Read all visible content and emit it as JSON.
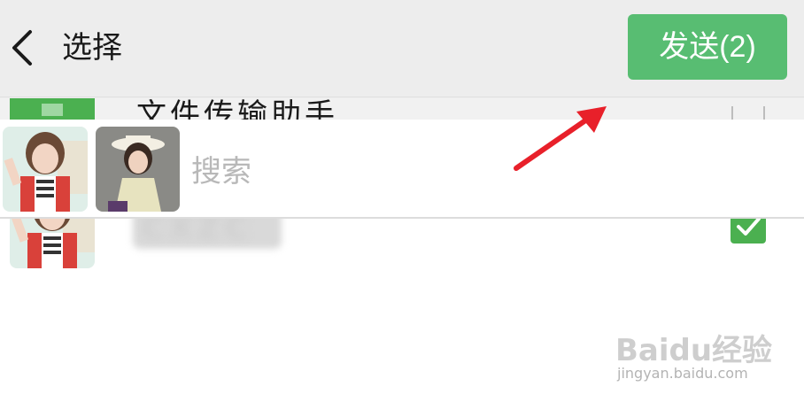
{
  "header": {
    "title": "选择",
    "send_label": "发送(2)"
  },
  "search": {
    "placeholder": "搜索"
  },
  "list": {
    "items": [
      {
        "label": "文件传输助手",
        "checked": false
      },
      {
        "label": "CXZC",
        "checked": true
      }
    ]
  },
  "selected_count": 2,
  "watermark": {
    "brand": "Baidu经验",
    "url": "jingyan.baidu.com"
  },
  "colors": {
    "accent": "#58bd72",
    "arrow": "#e8202a"
  }
}
